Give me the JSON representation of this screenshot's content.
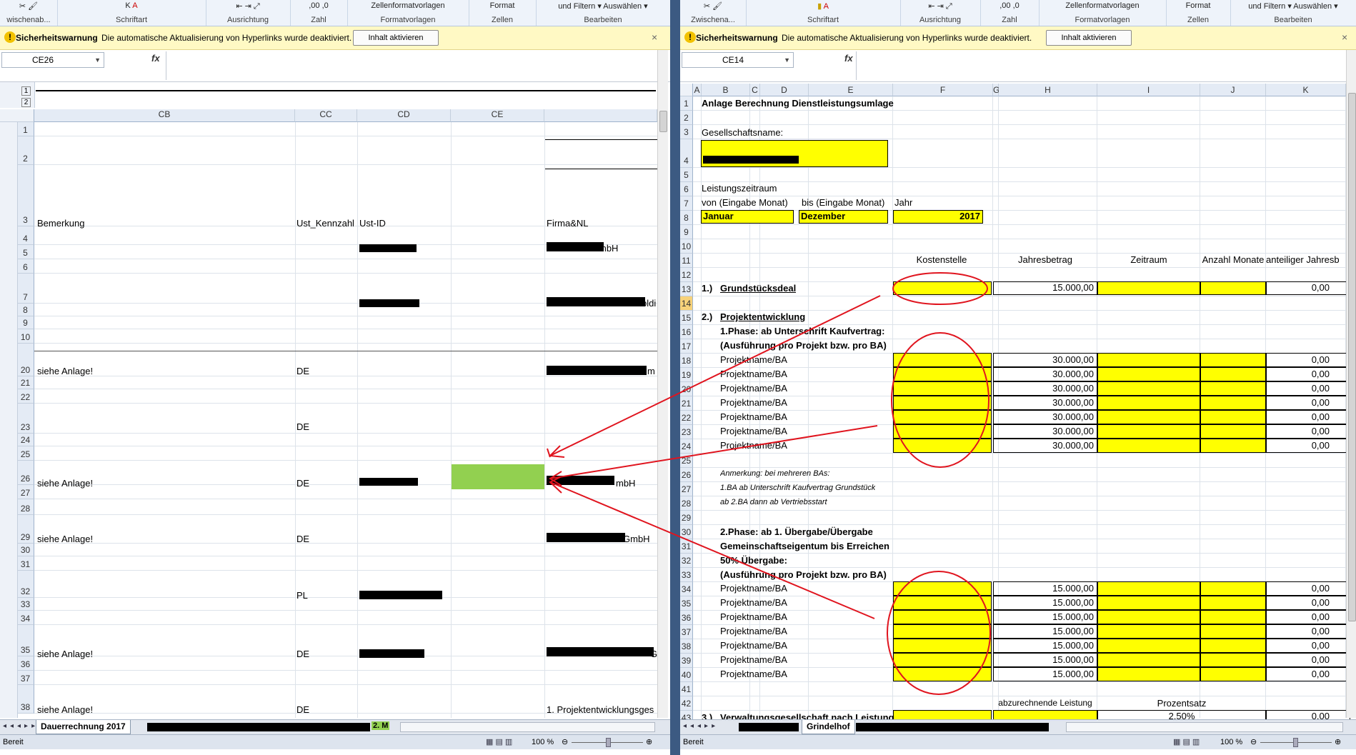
{
  "ribbon": {
    "groups": [
      "Schriftart",
      "Ausrichtung",
      "Zahl",
      "Formatvorlagen",
      "Zellen",
      "Bearbeiten"
    ],
    "clipboard_label": "Zwischena...",
    "clipboard_label_left": "wischenab...",
    "cell_styles": "Zellenformatvorlagen",
    "format": "Format",
    "sort_filter": "und Filtern",
    "select": "Auswählen"
  },
  "security_bar": {
    "title": "Sicherheitswarnung",
    "message": "Die automatische Aktualisierung von Hyperlinks wurde deaktiviert.",
    "button": "Inhalt aktivieren",
    "close": "×"
  },
  "left": {
    "name_box": "CE26",
    "fx": "fx",
    "outline_levels": [
      "1",
      "2"
    ],
    "columns": [
      {
        "name": "CB"
      },
      {
        "name": "CC"
      },
      {
        "name": "CD"
      },
      {
        "name": "CE"
      },
      {
        "name": ""
      }
    ],
    "header_row": {
      "bemerkung": "Bemerkung",
      "ust_kz": "Ust_Kennzahl",
      "ust_id": "Ust-ID",
      "firma": "Firma&NL"
    },
    "rows": [
      "1",
      "2",
      "3",
      "4",
      "5",
      "6",
      "7",
      "8",
      "9",
      "10",
      "20",
      "21",
      "22",
      "23",
      "24",
      "25",
      "26",
      "27",
      "28",
      "29",
      "30",
      "31",
      "32",
      "33",
      "34",
      "35",
      "36",
      "37",
      "38"
    ],
    "cells": {
      "r4_firma": "mbH",
      "r7_firma": "bldi",
      "r20_bem": "siehe Anlage!",
      "r20_cc": "DE",
      "r20_firma": "m",
      "r23_cc": "DE",
      "r26_bem": "siehe Anlage!",
      "r26_cc": "DE",
      "r26_firma": "mbH",
      "r29_bem": "siehe Anlage!",
      "r29_cc": "DE",
      "r29_firma": "GmbH",
      "r32_cc": "PL",
      "r35_bem": "siehe Anlage!",
      "r35_cc": "DE",
      "r35_firma": "G",
      "r38_bem": "siehe Anlage!",
      "r38_cc": "DE",
      "r38_firma": "1. Projektentwicklungsges"
    },
    "sheet_tab": "Dauerrechnung 2017",
    "sheet_tab_suffix": "2. M",
    "status": "Bereit",
    "zoom": "100 %"
  },
  "right": {
    "name_box": "CE14",
    "fx": "fx",
    "columns": [
      "A",
      "B",
      "C",
      "D",
      "E",
      "F",
      "G",
      "H",
      "I",
      "J",
      "K"
    ],
    "rows": [
      "1",
      "2",
      "3",
      "4",
      "5",
      "6",
      "7",
      "8",
      "9",
      "10",
      "11",
      "12",
      "13",
      "14",
      "15",
      "16",
      "17",
      "18",
      "19",
      "20",
      "21",
      "22",
      "23",
      "24",
      "25",
      "26",
      "27",
      "28",
      "29",
      "30",
      "31",
      "32",
      "33",
      "34",
      "35",
      "36",
      "37",
      "38",
      "39",
      "40",
      "41",
      "42",
      "43"
    ],
    "title": "Anlage Berechnung Dienstleistungsumlage",
    "company_label": "Gesellschaftsname:",
    "period_label": "Leistungszeitraum",
    "from_label": "von (Eingabe Monat)",
    "to_label": "bis (Eingabe Monat)",
    "year_label": "Jahr",
    "from_value": "Januar",
    "to_value": "Dezember",
    "year_value": "2017",
    "hdr_kostenstelle": "Kostenstelle",
    "hdr_jahresbetrag": "Jahresbetrag",
    "hdr_zeitraum": "Zeitraum",
    "hdr_anzahl": "Anzahl Monate",
    "hdr_anteilig": "anteiliger Jahresb",
    "item1_no": "1.)",
    "item1_label": "Grundstücksdeal",
    "item1_amount": "15.000,00",
    "item1_result": "0,00",
    "item2_no": "2.)",
    "item2_label": "Projektentwicklung",
    "phase1_line1": "1.Phase: ab Unterschrift Kaufvertrag:",
    "phase1_line2": "(Ausführung pro Projekt bzw. pro BA)",
    "project_label": "Projektname/BA",
    "phase1_amount": "30.000,00",
    "zero": "0,00",
    "note1": "Anmerkung: bei mehreren BAs:",
    "note2": "1.BA ab Unterschrift Kaufvertrag Grundstück",
    "note3": "ab 2.BA dann ab Vertriebsstart",
    "phase2_line1": "2.Phase: ab 1. Übergabe/Übergabe",
    "phase2_line2": "Gemeinschaftseigentum bis Erreichen",
    "phase2_line3": "50% Übergabe:",
    "phase2_line4": "(Ausführung pro Projekt bzw. pro BA)",
    "phase2_amount": "15.000,00",
    "hdr_abzurechnen": "abzurechnende Leistung",
    "hdr_prozentsatz": "Prozentsatz",
    "item3_no": "3.)",
    "item3_label": "Verwaltungsgesellschaft nach Leistung",
    "item3_percent": "2,50%",
    "item3_result": "0,00",
    "sheet_tab": "Grindelhof",
    "status": "Bereit",
    "zoom": "100 %"
  },
  "colors": {
    "input_yellow": "#ffff00",
    "selected_green": "#92d050",
    "annotation_red": "#e0141e",
    "header_blue": "#e4ebf5"
  }
}
